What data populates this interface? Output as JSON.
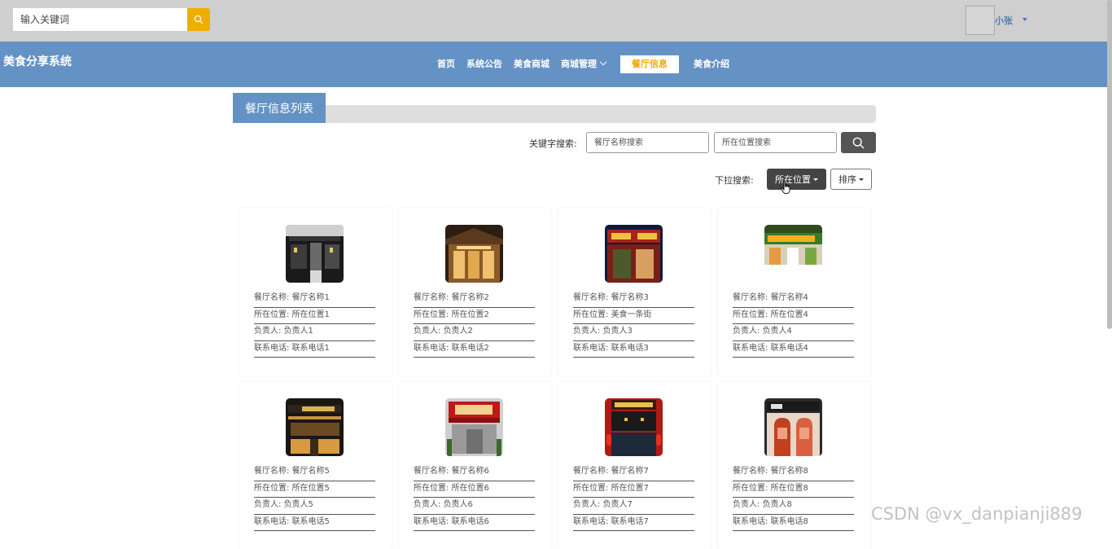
{
  "header": {
    "search_placeholder": "输入关键词",
    "username": "小张"
  },
  "navbar": {
    "site_title": "美食分享系统",
    "items": [
      {
        "label": "首页"
      },
      {
        "label": "系统公告"
      },
      {
        "label": "美食商城"
      },
      {
        "label": "商城管理",
        "has_dropdown": true
      },
      {
        "label": "餐厅信息",
        "active": true
      },
      {
        "label": "美食介绍"
      }
    ]
  },
  "list": {
    "title": "餐厅信息列表",
    "keyword_label": "关键字搜索:",
    "name_placeholder": "餐厅名称搜索",
    "location_placeholder": "所在位置搜索",
    "dropdown_label": "下拉搜索:",
    "location_dropdown": "所在位置",
    "sort_dropdown": "排序"
  },
  "colors": {
    "brand_blue": "#6592c5",
    "accent": "#f0ad00",
    "dark_button": "#444444"
  },
  "restaurants": [
    {
      "name_label": "餐厅名称:",
      "name": "餐厅名称1",
      "location_label": "所在位置:",
      "location": "所在位置1",
      "manager_label": "负责人:",
      "manager": "负责人1",
      "phone_label": "联系电话:",
      "phone": "联系电话1"
    },
    {
      "name_label": "餐厅名称:",
      "name": "餐厅名称2",
      "location_label": "所在位置:",
      "location": "所在位置2",
      "manager_label": "负责人:",
      "manager": "负责人2",
      "phone_label": "联系电话:",
      "phone": "联系电话2"
    },
    {
      "name_label": "餐厅名称:",
      "name": "餐厅名称3",
      "location_label": "所在位置:",
      "location": "美食一条街",
      "manager_label": "负责人:",
      "manager": "负责人3",
      "phone_label": "联系电话:",
      "phone": "联系电话3"
    },
    {
      "name_label": "餐厅名称:",
      "name": "餐厅名称4",
      "location_label": "所在位置:",
      "location": "所在位置4",
      "manager_label": "负责人:",
      "manager": "负责人4",
      "phone_label": "联系电话:",
      "phone": "联系电话4"
    },
    {
      "name_label": "餐厅名称:",
      "name": "餐厅名称5",
      "location_label": "所在位置:",
      "location": "所在位置5",
      "manager_label": "负责人:",
      "manager": "负责人5",
      "phone_label": "联系电话:",
      "phone": "联系电话5"
    },
    {
      "name_label": "餐厅名称:",
      "name": "餐厅名称6",
      "location_label": "所在位置:",
      "location": "所在位置6",
      "manager_label": "负责人:",
      "manager": "负责人6",
      "phone_label": "联系电话:",
      "phone": "联系电话6"
    },
    {
      "name_label": "餐厅名称:",
      "name": "餐厅名称7",
      "location_label": "所在位置:",
      "location": "所在位置7",
      "manager_label": "负责人:",
      "manager": "负责人7",
      "phone_label": "联系电话:",
      "phone": "联系电话7"
    },
    {
      "name_label": "餐厅名称:",
      "name": "餐厅名称8",
      "location_label": "所在位置:",
      "location": "所在位置8",
      "manager_label": "负责人:",
      "manager": "负责人8",
      "phone_label": "联系电话:",
      "phone": "联系电话8"
    }
  ],
  "watermark": "CSDN @vx_danpianji889"
}
